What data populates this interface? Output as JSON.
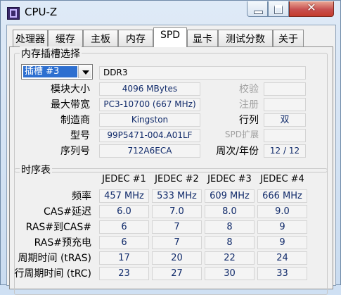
{
  "window": {
    "title": "CPU-Z",
    "close_glyph": "✕"
  },
  "tabs": [
    "处理器",
    "缓存",
    "主板",
    "内存",
    "SPD",
    "显卡",
    "测试分数",
    "关于"
  ],
  "active_tab": "SPD",
  "slot_group": {
    "title": "内存插槽选择",
    "slot": "插槽 #3",
    "memory_type": "DDR3",
    "left_labels": {
      "module_size": "模块大小",
      "max_bandwidth": "最大带宽",
      "manufacturer": "制造商",
      "part_number": "型号",
      "serial_number": "序列号"
    },
    "left_values": {
      "module_size": "4096 MBytes",
      "max_bandwidth": "PC3-10700 (667 MHz)",
      "manufacturer": "Kingston",
      "part_number": "99P5471-004.A01LF",
      "serial_number": "712A6ECA"
    },
    "right_labels": {
      "correction": "校验",
      "registered": "注册",
      "ranks": "行列",
      "spd_ext": "SPD扩展",
      "week_year": "周次/年份"
    },
    "right_values": {
      "correction": "",
      "registered": "",
      "ranks": "双",
      "spd_ext": "",
      "week_year": "12 / 12"
    }
  },
  "timing_group": {
    "title": "时序表",
    "columns": [
      "JEDEC #1",
      "JEDEC #2",
      "JEDEC #3",
      "JEDEC #4"
    ],
    "rows": [
      {
        "label": "频率",
        "values": [
          "457 MHz",
          "533 MHz",
          "609 MHz",
          "666 MHz"
        ]
      },
      {
        "label": "CAS#延迟",
        "values": [
          "6.0",
          "7.0",
          "8.0",
          "9.0"
        ]
      },
      {
        "label": "RAS#到CAS#",
        "values": [
          "6",
          "7",
          "8",
          "9"
        ]
      },
      {
        "label": "RAS#预充电",
        "values": [
          "6",
          "7",
          "8",
          "9"
        ]
      },
      {
        "label": "周期时间 (tRAS)",
        "values": [
          "17",
          "20",
          "22",
          "24"
        ]
      },
      {
        "label": "行周期时间 (tRC)",
        "values": [
          "23",
          "27",
          "30",
          "33"
        ]
      }
    ]
  },
  "colors": {
    "title_bar": "#dfeaf7",
    "close_button": "#c75050",
    "selection": "#2d6fd0",
    "value_text": "#102a6a"
  }
}
